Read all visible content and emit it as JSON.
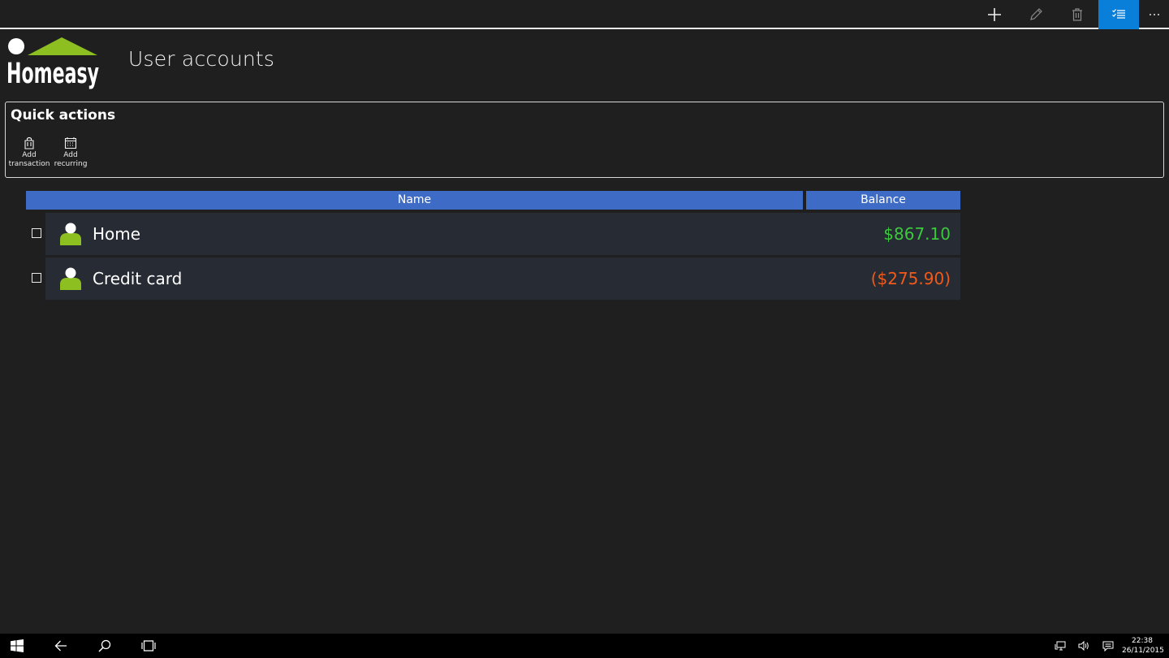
{
  "app": {
    "logo_text": "Homeasy",
    "page_title": "User accounts"
  },
  "command_bar": {
    "buttons": [
      {
        "icon": "add-icon",
        "label": "Add"
      },
      {
        "icon": "edit-icon",
        "label": "Edit"
      },
      {
        "icon": "delete-icon",
        "label": "Delete"
      },
      {
        "icon": "select-icon",
        "label": "Select",
        "active": true
      },
      {
        "icon": "more-icon",
        "label": "More"
      }
    ],
    "active_color": "#0a7fd9"
  },
  "quick_actions": {
    "title": "Quick actions",
    "items": [
      {
        "icon": "bag-icon",
        "label": "Add\ntransaction"
      },
      {
        "icon": "calendar-icon",
        "label": "Add\nrecurring"
      }
    ]
  },
  "table": {
    "columns": [
      "Name",
      "Balance"
    ],
    "header_color": "#3e6bc6",
    "rows": [
      {
        "name": "Home",
        "balance": "$867.10",
        "balance_color": "#3cc83c",
        "checked": false
      },
      {
        "name": "Credit card",
        "balance": "($275.90)",
        "balance_color": "#f05a1a",
        "checked": false
      }
    ]
  },
  "taskbar": {
    "time": "22:38",
    "date": "26/11/2015",
    "icons": [
      "windows-start-icon",
      "back-icon",
      "search-icon",
      "task-view-icon",
      "network-icon",
      "volume-icon",
      "notifications-icon"
    ]
  },
  "colors": {
    "background": "#1f1f1f",
    "row_background": "#272b34",
    "avatar_green": "#8cbf1f",
    "logo_green": "#8cbf1f"
  }
}
